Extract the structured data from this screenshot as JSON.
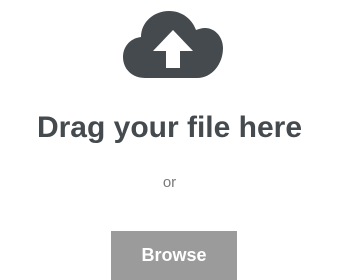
{
  "upload": {
    "icon": "cloud-upload-icon",
    "title": "Drag your file here",
    "separator": "or",
    "browse_label": "Browse"
  },
  "colors": {
    "icon": "#454a4e",
    "title": "#444a4e",
    "separator": "#7a7a7a",
    "button_bg": "#9b9b9b",
    "button_text": "#ffffff"
  }
}
